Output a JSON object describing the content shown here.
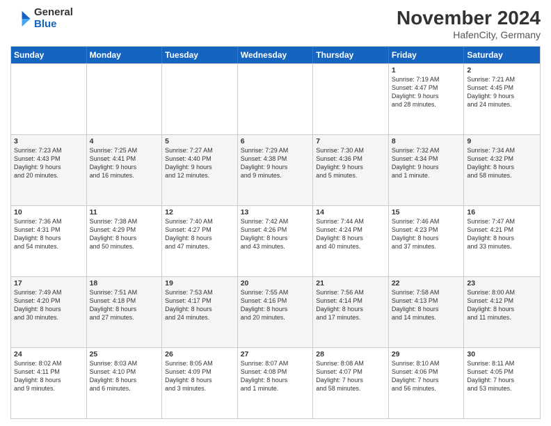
{
  "header": {
    "logo_general": "General",
    "logo_blue": "Blue",
    "month_title": "November 2024",
    "location": "HafenCity, Germany"
  },
  "weekdays": [
    "Sunday",
    "Monday",
    "Tuesday",
    "Wednesday",
    "Thursday",
    "Friday",
    "Saturday"
  ],
  "rows": [
    [
      {
        "day": "",
        "info": ""
      },
      {
        "day": "",
        "info": ""
      },
      {
        "day": "",
        "info": ""
      },
      {
        "day": "",
        "info": ""
      },
      {
        "day": "",
        "info": ""
      },
      {
        "day": "1",
        "info": "Sunrise: 7:19 AM\nSunset: 4:47 PM\nDaylight: 9 hours\nand 28 minutes."
      },
      {
        "day": "2",
        "info": "Sunrise: 7:21 AM\nSunset: 4:45 PM\nDaylight: 9 hours\nand 24 minutes."
      }
    ],
    [
      {
        "day": "3",
        "info": "Sunrise: 7:23 AM\nSunset: 4:43 PM\nDaylight: 9 hours\nand 20 minutes."
      },
      {
        "day": "4",
        "info": "Sunrise: 7:25 AM\nSunset: 4:41 PM\nDaylight: 9 hours\nand 16 minutes."
      },
      {
        "day": "5",
        "info": "Sunrise: 7:27 AM\nSunset: 4:40 PM\nDaylight: 9 hours\nand 12 minutes."
      },
      {
        "day": "6",
        "info": "Sunrise: 7:29 AM\nSunset: 4:38 PM\nDaylight: 9 hours\nand 9 minutes."
      },
      {
        "day": "7",
        "info": "Sunrise: 7:30 AM\nSunset: 4:36 PM\nDaylight: 9 hours\nand 5 minutes."
      },
      {
        "day": "8",
        "info": "Sunrise: 7:32 AM\nSunset: 4:34 PM\nDaylight: 9 hours\nand 1 minute."
      },
      {
        "day": "9",
        "info": "Sunrise: 7:34 AM\nSunset: 4:32 PM\nDaylight: 8 hours\nand 58 minutes."
      }
    ],
    [
      {
        "day": "10",
        "info": "Sunrise: 7:36 AM\nSunset: 4:31 PM\nDaylight: 8 hours\nand 54 minutes."
      },
      {
        "day": "11",
        "info": "Sunrise: 7:38 AM\nSunset: 4:29 PM\nDaylight: 8 hours\nand 50 minutes."
      },
      {
        "day": "12",
        "info": "Sunrise: 7:40 AM\nSunset: 4:27 PM\nDaylight: 8 hours\nand 47 minutes."
      },
      {
        "day": "13",
        "info": "Sunrise: 7:42 AM\nSunset: 4:26 PM\nDaylight: 8 hours\nand 43 minutes."
      },
      {
        "day": "14",
        "info": "Sunrise: 7:44 AM\nSunset: 4:24 PM\nDaylight: 8 hours\nand 40 minutes."
      },
      {
        "day": "15",
        "info": "Sunrise: 7:46 AM\nSunset: 4:23 PM\nDaylight: 8 hours\nand 37 minutes."
      },
      {
        "day": "16",
        "info": "Sunrise: 7:47 AM\nSunset: 4:21 PM\nDaylight: 8 hours\nand 33 minutes."
      }
    ],
    [
      {
        "day": "17",
        "info": "Sunrise: 7:49 AM\nSunset: 4:20 PM\nDaylight: 8 hours\nand 30 minutes."
      },
      {
        "day": "18",
        "info": "Sunrise: 7:51 AM\nSunset: 4:18 PM\nDaylight: 8 hours\nand 27 minutes."
      },
      {
        "day": "19",
        "info": "Sunrise: 7:53 AM\nSunset: 4:17 PM\nDaylight: 8 hours\nand 24 minutes."
      },
      {
        "day": "20",
        "info": "Sunrise: 7:55 AM\nSunset: 4:16 PM\nDaylight: 8 hours\nand 20 minutes."
      },
      {
        "day": "21",
        "info": "Sunrise: 7:56 AM\nSunset: 4:14 PM\nDaylight: 8 hours\nand 17 minutes."
      },
      {
        "day": "22",
        "info": "Sunrise: 7:58 AM\nSunset: 4:13 PM\nDaylight: 8 hours\nand 14 minutes."
      },
      {
        "day": "23",
        "info": "Sunrise: 8:00 AM\nSunset: 4:12 PM\nDaylight: 8 hours\nand 11 minutes."
      }
    ],
    [
      {
        "day": "24",
        "info": "Sunrise: 8:02 AM\nSunset: 4:11 PM\nDaylight: 8 hours\nand 9 minutes."
      },
      {
        "day": "25",
        "info": "Sunrise: 8:03 AM\nSunset: 4:10 PM\nDaylight: 8 hours\nand 6 minutes."
      },
      {
        "day": "26",
        "info": "Sunrise: 8:05 AM\nSunset: 4:09 PM\nDaylight: 8 hours\nand 3 minutes."
      },
      {
        "day": "27",
        "info": "Sunrise: 8:07 AM\nSunset: 4:08 PM\nDaylight: 8 hours\nand 1 minute."
      },
      {
        "day": "28",
        "info": "Sunrise: 8:08 AM\nSunset: 4:07 PM\nDaylight: 7 hours\nand 58 minutes."
      },
      {
        "day": "29",
        "info": "Sunrise: 8:10 AM\nSunset: 4:06 PM\nDaylight: 7 hours\nand 56 minutes."
      },
      {
        "day": "30",
        "info": "Sunrise: 8:11 AM\nSunset: 4:05 PM\nDaylight: 7 hours\nand 53 minutes."
      }
    ]
  ]
}
